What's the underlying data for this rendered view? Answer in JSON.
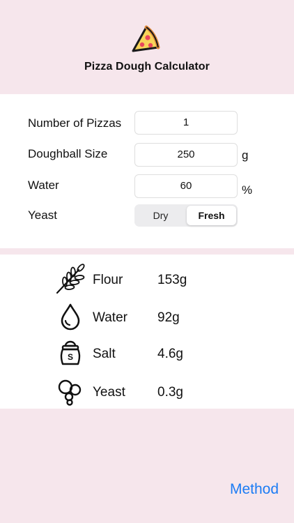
{
  "app": {
    "title": "Pizza Dough Calculator"
  },
  "inputs": {
    "pizzas": {
      "label": "Number of Pizzas",
      "value": "1"
    },
    "doughball": {
      "label": "Doughball Size",
      "value": "250",
      "unit": "g"
    },
    "water": {
      "label": "Water",
      "value": "60",
      "unit": "%"
    },
    "yeast": {
      "label": "Yeast",
      "options": [
        "Dry",
        "Fresh"
      ],
      "selected": "Fresh"
    }
  },
  "results": [
    {
      "name": "Flour",
      "value": "153g",
      "icon": "wheat-icon"
    },
    {
      "name": "Water",
      "value": "92g",
      "icon": "water-drop-icon"
    },
    {
      "name": "Salt",
      "value": "4.6g",
      "icon": "salt-shaker-icon"
    },
    {
      "name": "Yeast",
      "value": "0.3g",
      "icon": "bubbles-icon"
    }
  ],
  "footer": {
    "method_label": "Method"
  },
  "colors": {
    "background": "#f6e6ec",
    "accent": "#1c7cf4"
  }
}
